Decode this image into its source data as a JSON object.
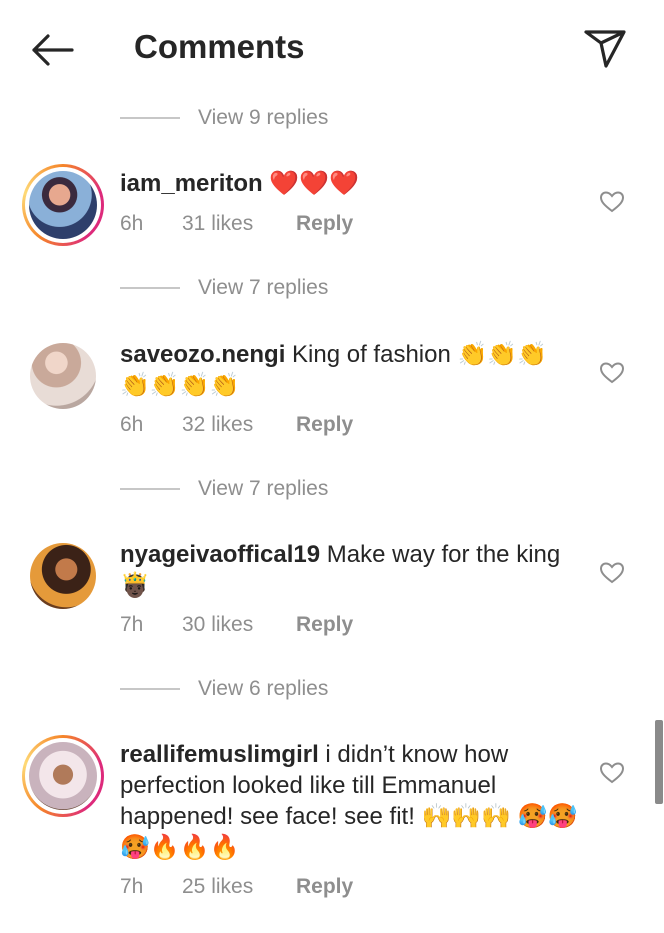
{
  "header": {
    "title": "Comments"
  },
  "icons": {
    "back": "arrow-left-icon",
    "share": "paper-plane-icon",
    "like": "heart-outline-icon"
  },
  "colors": {
    "text": "#262626",
    "muted": "#8e8e8e",
    "divider": "#c7c7c7",
    "heart": "#e0245e",
    "story_ring": "#dd2a7b"
  },
  "view_replies": [
    "View 9 replies",
    "View 7 replies",
    "View 7 replies",
    "View 6 replies"
  ],
  "comments": [
    {
      "username": "iam_meriton",
      "text": " ❤️❤️❤️",
      "time": "6h",
      "likes": "31 likes",
      "reply": "Reply"
    },
    {
      "username": "saveozo.nengi",
      "text": " King of fashion 👏👏👏 👏👏👏👏",
      "time": "6h",
      "likes": "32 likes",
      "reply": "Reply"
    },
    {
      "username": "nyageivaoffical19",
      "text": " Make way for the king 🤴🏿",
      "time": "7h",
      "likes": "30 likes",
      "reply": "Reply"
    },
    {
      "username": "reallifemuslimgirl",
      "text": " i didn’t know how perfection looked like till Emmanuel happened! see face! see fit! 🙌🙌🙌 🥵🥵🥵🔥🔥🔥",
      "time": "7h",
      "likes": "25 likes",
      "reply": "Reply"
    }
  ]
}
